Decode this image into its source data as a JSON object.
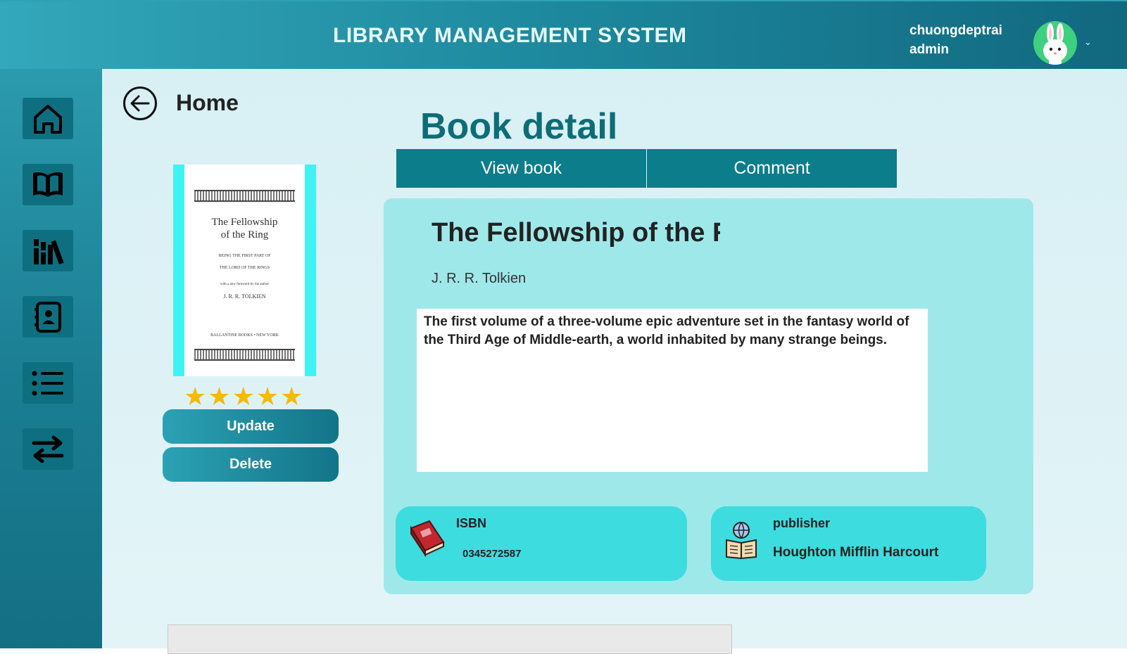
{
  "header": {
    "title": "LIBRARY MANAGEMENT SYSTEM",
    "user_name": "chuongdeptrai",
    "user_role": "admin"
  },
  "sidebar": {
    "items": [
      {
        "icon": "home-icon"
      },
      {
        "icon": "book-icon"
      },
      {
        "icon": "library-icon"
      },
      {
        "icon": "contacts-icon"
      },
      {
        "icon": "list-icon"
      },
      {
        "icon": "transfer-icon"
      }
    ]
  },
  "nav": {
    "back_label": "Home"
  },
  "page": {
    "title": "Book detail"
  },
  "tabs": [
    {
      "label": "View book"
    },
    {
      "label": "Comment"
    }
  ],
  "book": {
    "title": "The Fellowship of the R",
    "author": "J. R. R. Tolkien",
    "description": "The first volume of a three-volume epic adventure set in the fantasy world of the Third Age of Middle-earth, a world inhabited by many strange beings.",
    "rating": 5,
    "cover": {
      "title_line1": "The Fellowship",
      "title_line2": "of the Ring",
      "sub1": "BEING THE FIRST PART OF",
      "sub2": "THE LORD OF THE RINGS",
      "sub3": "with a new foreword by the author",
      "author": "J. R. R. TOLKIEN",
      "publisher": "BALLANTINE BOOKS  •  NEW YORK"
    }
  },
  "actions": {
    "update_label": "Update",
    "delete_label": "Delete"
  },
  "info": {
    "isbn_label": "ISBN",
    "isbn_value": "0345272587",
    "publisher_label": "publisher",
    "publisher_value": "Houghton Mifflin Harcourt"
  },
  "colors": {
    "accent": "#0b7d8b",
    "panel": "#9fe8ea",
    "card": "#3ddcdf",
    "star": "#f7b80a"
  }
}
